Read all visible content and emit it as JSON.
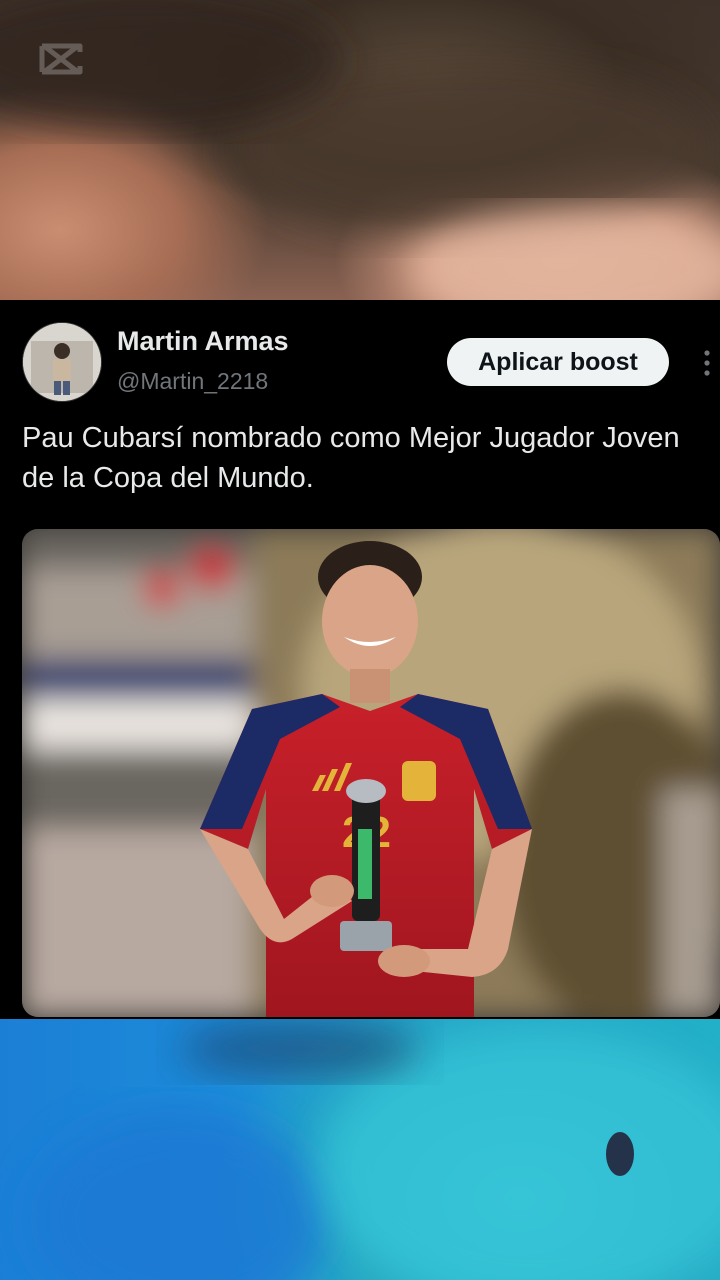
{
  "app": {
    "logo_icon": "capcut-logo-icon"
  },
  "tweet": {
    "author_name": "Martin Armas",
    "author_handle": "@Martin_2218",
    "boost_label": "Aplicar boost",
    "text": "Pau Cubarsí nombrado como Mejor Jugador Joven de la Copa del Mundo.",
    "media_description_icon": "player-trophy-photo"
  },
  "colors": {
    "background": "#000000",
    "text_primary": "#e7e9ea",
    "text_secondary": "#71767b",
    "button_bg": "#eff3f4"
  }
}
